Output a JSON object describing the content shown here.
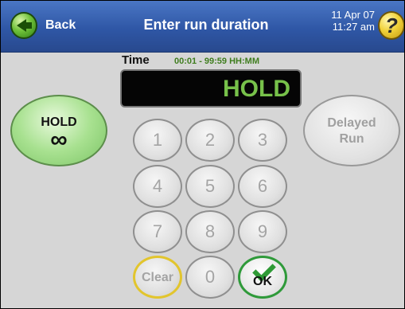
{
  "header": {
    "back_label": "Back",
    "title": "Enter run duration",
    "date": "11 Apr 07",
    "time": "11:27 am",
    "help_glyph": "?"
  },
  "time_entry": {
    "label": "Time",
    "range": "00:01 - 99:59  HH:MM",
    "display_value": "HOLD"
  },
  "buttons": {
    "hold_label": "HOLD",
    "hold_symbol": "∞",
    "delayed_line1": "Delayed",
    "delayed_line2": "Run"
  },
  "keypad": {
    "keys": [
      "1",
      "2",
      "3",
      "4",
      "5",
      "6",
      "7",
      "8",
      "9"
    ],
    "clear_label": "Clear",
    "zero_label": "0",
    "ok_label": "OK"
  },
  "colors": {
    "header_blue": "#2f57a6",
    "display_text_green": "#77c14a",
    "hold_button_green": "#a8e190",
    "ok_border_green": "#2f9a3a",
    "clear_border_yellow": "#e2c52d"
  },
  "icons": {
    "back": "green-circle-left-arrow-icon",
    "help": "yellow-question-mark-icon",
    "ok": "green-check-icon"
  }
}
